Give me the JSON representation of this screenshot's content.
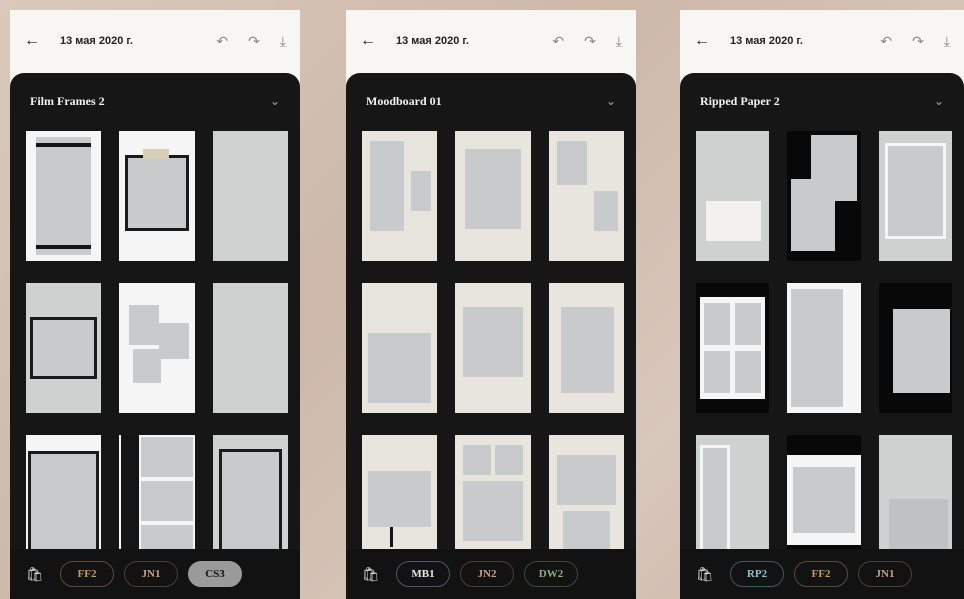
{
  "phones": [
    {
      "date": "13 мая 2020 г.",
      "title": "Film Frames 2",
      "pills": [
        {
          "label": "FF2",
          "color": "#c79a5e",
          "border": "#5b4a3a"
        },
        {
          "label": "JN1",
          "color": "#c7a38a",
          "border": "#4a3e38"
        },
        {
          "label": "CS3",
          "color": "#111111",
          "border": "#9a9a9a",
          "active": true
        }
      ]
    },
    {
      "date": "13 мая 2020 г.",
      "title": "Moodboard 01",
      "pills": [
        {
          "label": "MB1",
          "color": "#e6e6e6",
          "border": "#556"
        },
        {
          "label": "JN2",
          "color": "#c7a38a",
          "border": "#4a3e38"
        },
        {
          "label": "DW2",
          "color": "#8fb07a",
          "border": "#3a4a34"
        }
      ]
    },
    {
      "date": "13 мая 2020 г.",
      "title": "Ripped Paper 2",
      "pills": [
        {
          "label": "RP2",
          "color": "#8fc0d0",
          "border": "#3d5a66"
        },
        {
          "label": "FF2",
          "color": "#c79a5e",
          "border": "#5b4a3a"
        },
        {
          "label": "JN1",
          "color": "#c7a38a",
          "border": "#4a3e38"
        }
      ]
    }
  ],
  "icons": {
    "back": "←",
    "undo": "↶",
    "redo": "↷",
    "download": "⤓",
    "chevron": "⌄",
    "shop": "🛍"
  }
}
